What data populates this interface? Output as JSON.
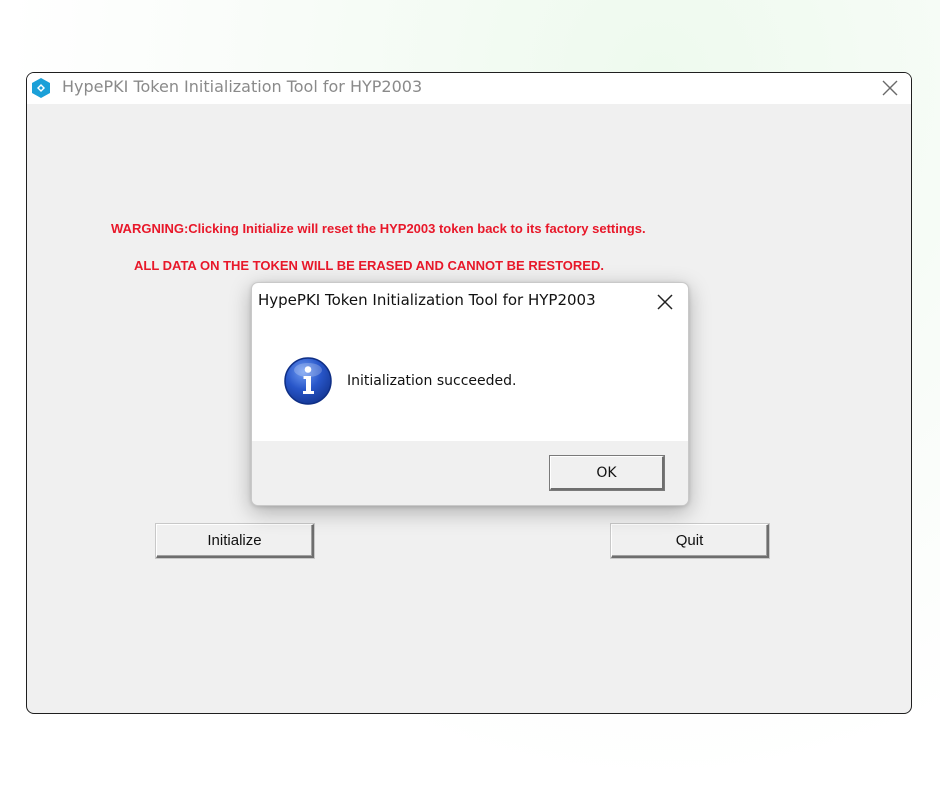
{
  "main_window": {
    "title": "HypePKI Token Initialization Tool for HYP2003",
    "icon": "app-logo-icon",
    "close_icon": "close-icon",
    "warning_line1": "WARGNING:Clicking Initialize will reset the HYP2003 token back to its factory settings.",
    "warning_line2": "ALL DATA ON THE TOKEN WILL BE ERASED AND CANNOT BE RESTORED.",
    "warning_color": "#e8182a",
    "initialize_label": "Initialize",
    "quit_label": "Quit"
  },
  "dialog": {
    "title": "HypePKI Token Initialization Tool for HYP2003",
    "close_icon": "close-icon",
    "icon": "info-icon",
    "message": "Initialization succeeded.",
    "ok_label": "OK"
  },
  "colors": {
    "window_bg": "#f0f0f0",
    "info_blue": "#1f4fc0",
    "app_icon_blue": "#1ba0d8"
  }
}
